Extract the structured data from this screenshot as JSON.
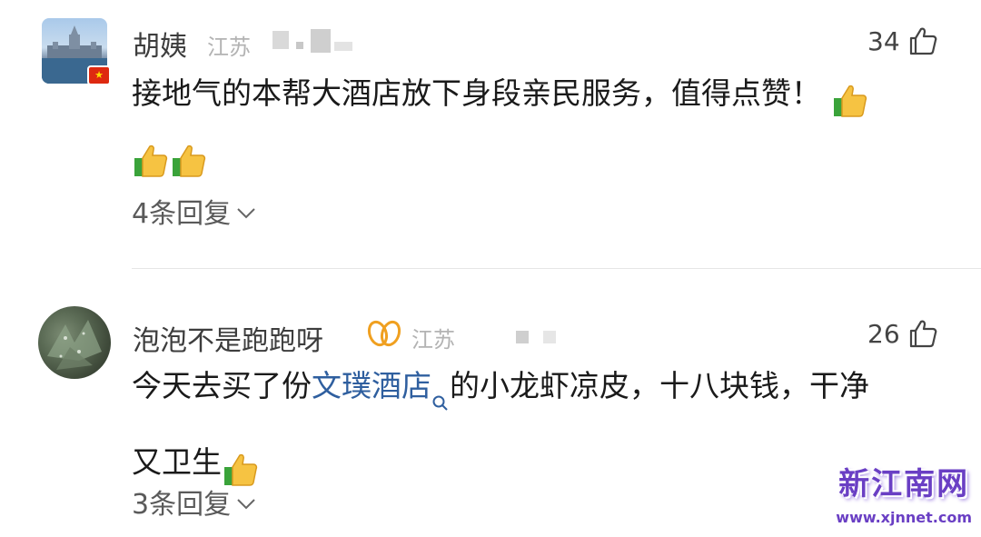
{
  "comments": [
    {
      "username": "胡姨",
      "location": "江苏",
      "likes": "34",
      "text_lines": [
        "接地气的本帮大酒店放下身段亲民服务，值得点赞！"
      ],
      "replies": "4条回复"
    },
    {
      "username": "泡泡不是跑跑呀",
      "location": "江苏",
      "likes": "26",
      "text_before_link": "今天去买了份",
      "link_text": "文璞酒店",
      "text_after_link": "的小龙虾凉皮，十八块钱，干净",
      "text_line2": "又卫生",
      "replies": "3条回复"
    }
  ],
  "watermark": {
    "title": "新江南网",
    "url": "www.xjnnet.com"
  },
  "icons": {
    "like": "thumbs-up-outline-icon",
    "emoji": "thumbs-up-emoji-icon",
    "search": "search-icon",
    "chevron": "chevron-down-icon",
    "vip": "vip-badge-icon",
    "flag": "china-flag-icon"
  },
  "colors": {
    "link": "#2f5f9f",
    "vip_badge": "#f0a020",
    "watermark": "#6a3fc4"
  }
}
